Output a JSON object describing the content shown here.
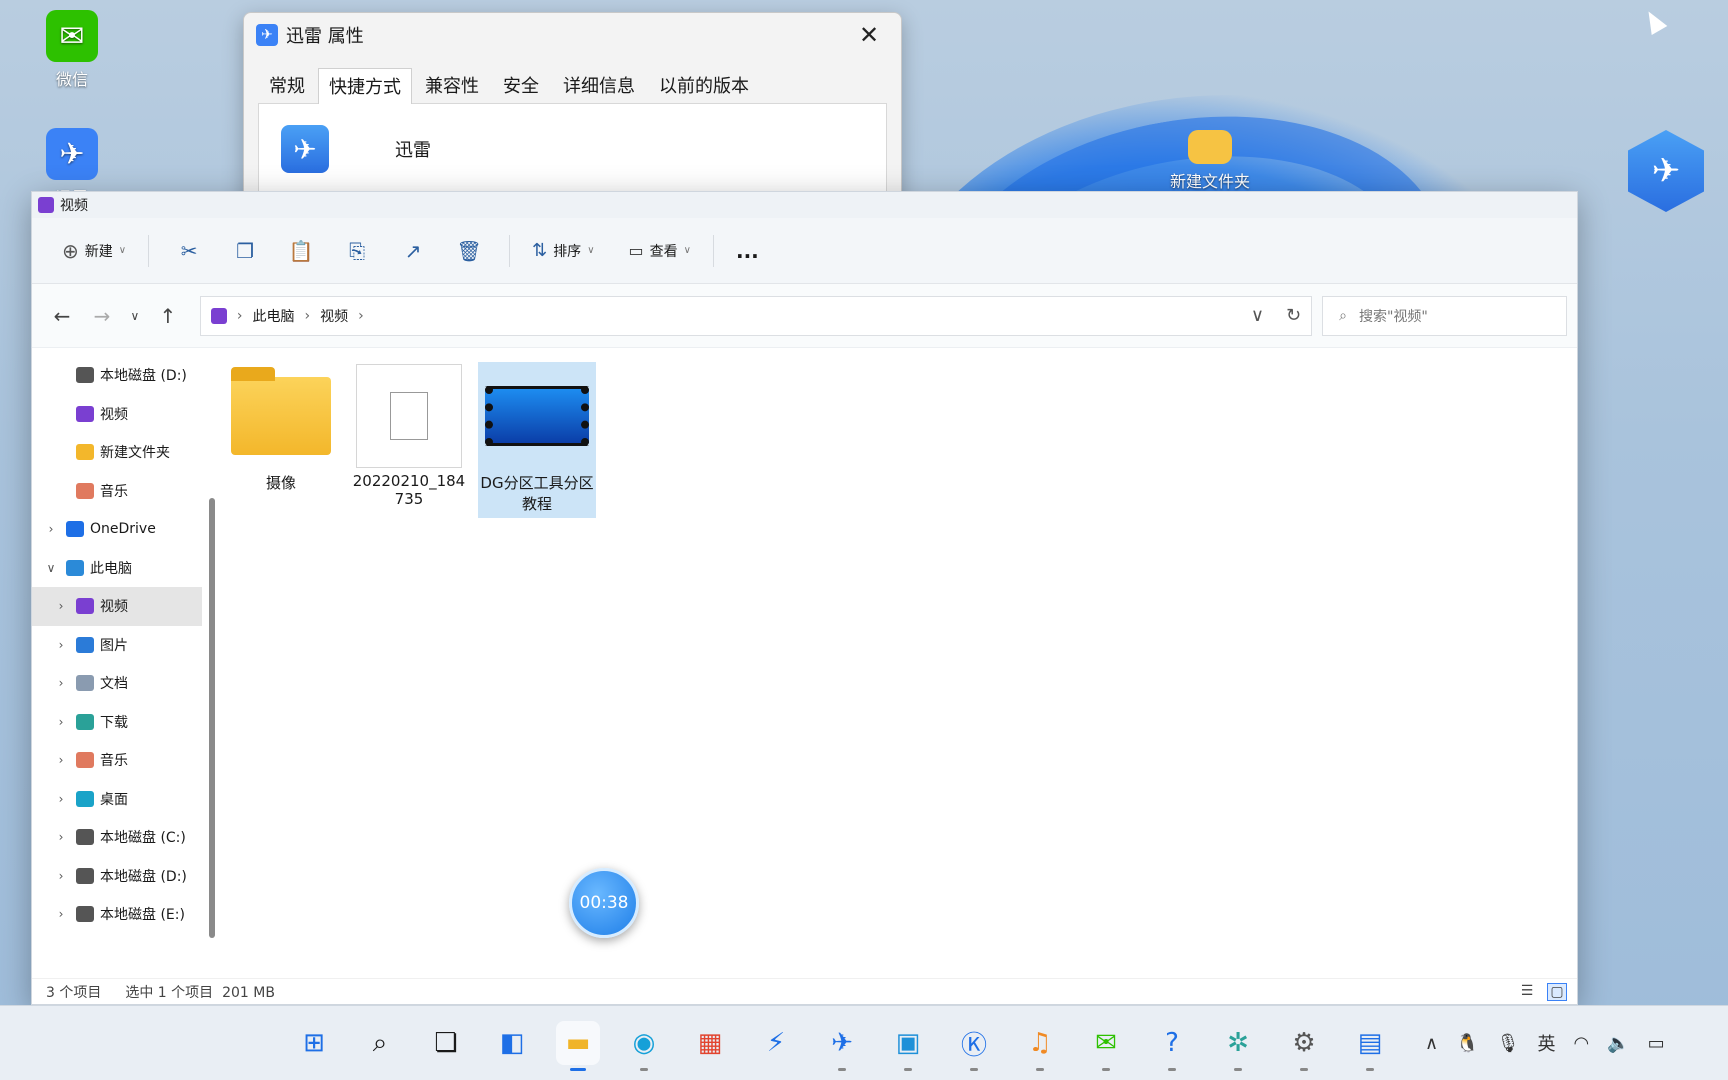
{
  "desktop": {
    "icons": [
      {
        "label": "微信",
        "icon": "wechat-icon"
      },
      {
        "label": "迅雷",
        "icon": "xunlei-icon"
      },
      {
        "label": "新建文件夹",
        "icon": "folder-icon"
      }
    ]
  },
  "dialog": {
    "title": "迅雷 属性",
    "tabs": [
      "常规",
      "快捷方式",
      "兼容性",
      "安全",
      "详细信息",
      "以前的版本"
    ],
    "active_tab": "快捷方式",
    "app_name": "迅雷"
  },
  "explorer": {
    "title": "视频",
    "toolbar": {
      "new_label": "新建",
      "sort_label": "排序",
      "view_label": "查看",
      "more": "..."
    },
    "address": {
      "crumbs": [
        "此电脑",
        "视频"
      ]
    },
    "search_placeholder": "搜索\"视频\"",
    "sidebar": [
      {
        "label": "本地磁盘 (D:)",
        "icon": "drive-icon",
        "level": 2,
        "expander": ""
      },
      {
        "label": "视频",
        "icon": "video-folder-icon",
        "level": 2,
        "expander": ""
      },
      {
        "label": "新建文件夹",
        "icon": "folder-icon",
        "level": 2,
        "expander": ""
      },
      {
        "label": "音乐",
        "icon": "music-icon",
        "level": 2,
        "expander": ""
      },
      {
        "label": "OneDrive",
        "icon": "cloud-icon",
        "level": 1,
        "expander": ">"
      },
      {
        "label": "此电脑",
        "icon": "pc-icon",
        "level": 1,
        "expander": "v"
      },
      {
        "label": "视频",
        "icon": "video-folder-icon",
        "level": 2,
        "expander": ">",
        "active": true
      },
      {
        "label": "图片",
        "icon": "picture-icon",
        "level": 2,
        "expander": ">"
      },
      {
        "label": "文档",
        "icon": "document-icon",
        "level": 2,
        "expander": ">"
      },
      {
        "label": "下载",
        "icon": "download-icon",
        "level": 2,
        "expander": ">"
      },
      {
        "label": "音乐",
        "icon": "music-icon",
        "level": 2,
        "expander": ">"
      },
      {
        "label": "桌面",
        "icon": "desktop-icon",
        "level": 2,
        "expander": ">"
      },
      {
        "label": "本地磁盘 (C:)",
        "icon": "drive-icon",
        "level": 2,
        "expander": ">"
      },
      {
        "label": "本地磁盘 (D:)",
        "icon": "drive-icon",
        "level": 2,
        "expander": ">"
      },
      {
        "label": "本地磁盘 (E:)",
        "icon": "drive-icon",
        "level": 2,
        "expander": ">"
      }
    ],
    "files": [
      {
        "name": "摄像",
        "type": "folder"
      },
      {
        "name": "20220210_184735",
        "type": "file"
      },
      {
        "name": "DG分区工具分区教程",
        "type": "video",
        "selected": true
      }
    ],
    "status": {
      "count": "3 个项目",
      "selection": "选中 1 个项目  201 MB"
    }
  },
  "timer": "00:38",
  "tray": {
    "ime": "英"
  },
  "colors": {
    "accent": "#1e6fe6",
    "selected": "#cce4f7",
    "video_folder": "#7a3fd1"
  }
}
